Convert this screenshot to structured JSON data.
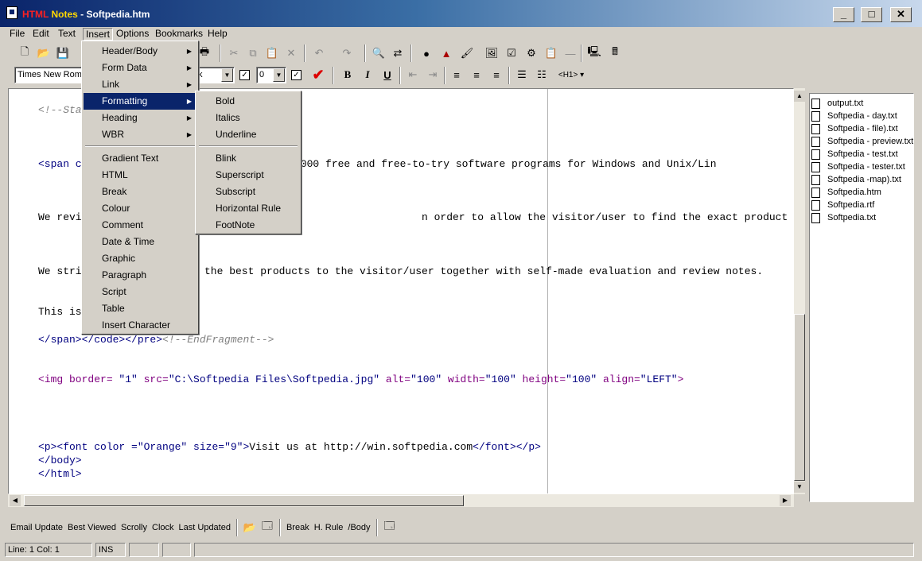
{
  "window": {
    "title_app_red": "HTML",
    "title_app_yellow": "Notes",
    "title_sep": " - ",
    "title_file": "Softpedia.htm",
    "min_label": "_",
    "max_label": "□",
    "close_label": "✕"
  },
  "menubar": [
    "File",
    "Edit",
    "Text",
    "Insert",
    "Options",
    "Bookmarks",
    "Help"
  ],
  "format_toolbar": {
    "font": "Times New Roman",
    "color_value": "k",
    "size": "0",
    "heading": "<H1>"
  },
  "insert_menu": [
    {
      "label": "Header/Body",
      "sub": true
    },
    {
      "label": "Form Data",
      "sub": true
    },
    {
      "label": "Link",
      "sub": true
    },
    {
      "label": "Formatting",
      "sub": true,
      "selected": true
    },
    {
      "label": "Heading",
      "sub": true
    },
    {
      "label": "WBR",
      "sub": true
    },
    {
      "label": "Gradient Text"
    },
    {
      "label": "HTML"
    },
    {
      "label": "Break"
    },
    {
      "label": "Colour"
    },
    {
      "label": "Comment"
    },
    {
      "label": "Date & Time"
    },
    {
      "label": "Graphic"
    },
    {
      "label": "Paragraph"
    },
    {
      "label": "Script"
    },
    {
      "label": "Table"
    },
    {
      "label": "Insert Character"
    }
  ],
  "formatting_submenu": [
    "Bold",
    "Italics",
    "Underline",
    "Blink",
    "Superscript",
    "Subscript",
    "Horizontal Rule",
    "FootNote"
  ],
  "editor_lines": {
    "l1": "<!--Sta",
    "l2a": "<span c",
    "l2b": "over 1,300,000 free and free-to-try software programs for Windows and Unix/Lin",
    "l3a": "We revi",
    "l3b": "n order to allow the visitor/user to find the exact product they and their sys",
    "l4a": "We stri",
    "l4b": "the best products to the visitor/user together with self-made evaluation and review notes.",
    "l5": "This is",
    "l6a": "</span></code></pre>",
    "l6b": "<!--EndFragment-->",
    "l7a": "<img border= ",
    "l7b": "\"1\"",
    "l7c": " src=",
    "l7d": "\"C:\\Softpedia Files\\Softpedia.jpg\"",
    "l7e": " alt=",
    "l7f": "\"100\"",
    "l7g": " width=",
    "l7h": "\"100\"",
    "l7i": " height=",
    "l7j": "\"100\"",
    "l7k": " align=",
    "l7l": "\"LEFT\"",
    "l7m": ">",
    "l8a": "<p><font color =",
    "l8b": "\"Orange\"",
    "l8c": " size=",
    "l8d": "\"9\"",
    "l8e": ">",
    "l8f": "Visit us at http://win.softpedia.com",
    "l8g": "</font></p>",
    "l9": "</body>",
    "l10": "</html>"
  },
  "files": [
    "output.txt",
    "Softpedia - day.txt",
    "Softpedia - file).txt",
    "Softpedia - preview.txt",
    "Softpedia - test.txt",
    "Softpedia - tester.txt",
    "Softpedia -map).txt",
    "Softpedia.htm",
    "Softpedia.rtf",
    "Softpedia.txt"
  ],
  "bottom_buttons": [
    "Email Update",
    "Best Viewed",
    "Scrolly",
    "Clock",
    "Last Updated"
  ],
  "bottom_buttons2": [
    "Break",
    "H. Rule",
    "/Body"
  ],
  "status": {
    "line_label": "Line:",
    "line": "1",
    "col_label": "Col:",
    "col": "1",
    "mode": "INS"
  }
}
